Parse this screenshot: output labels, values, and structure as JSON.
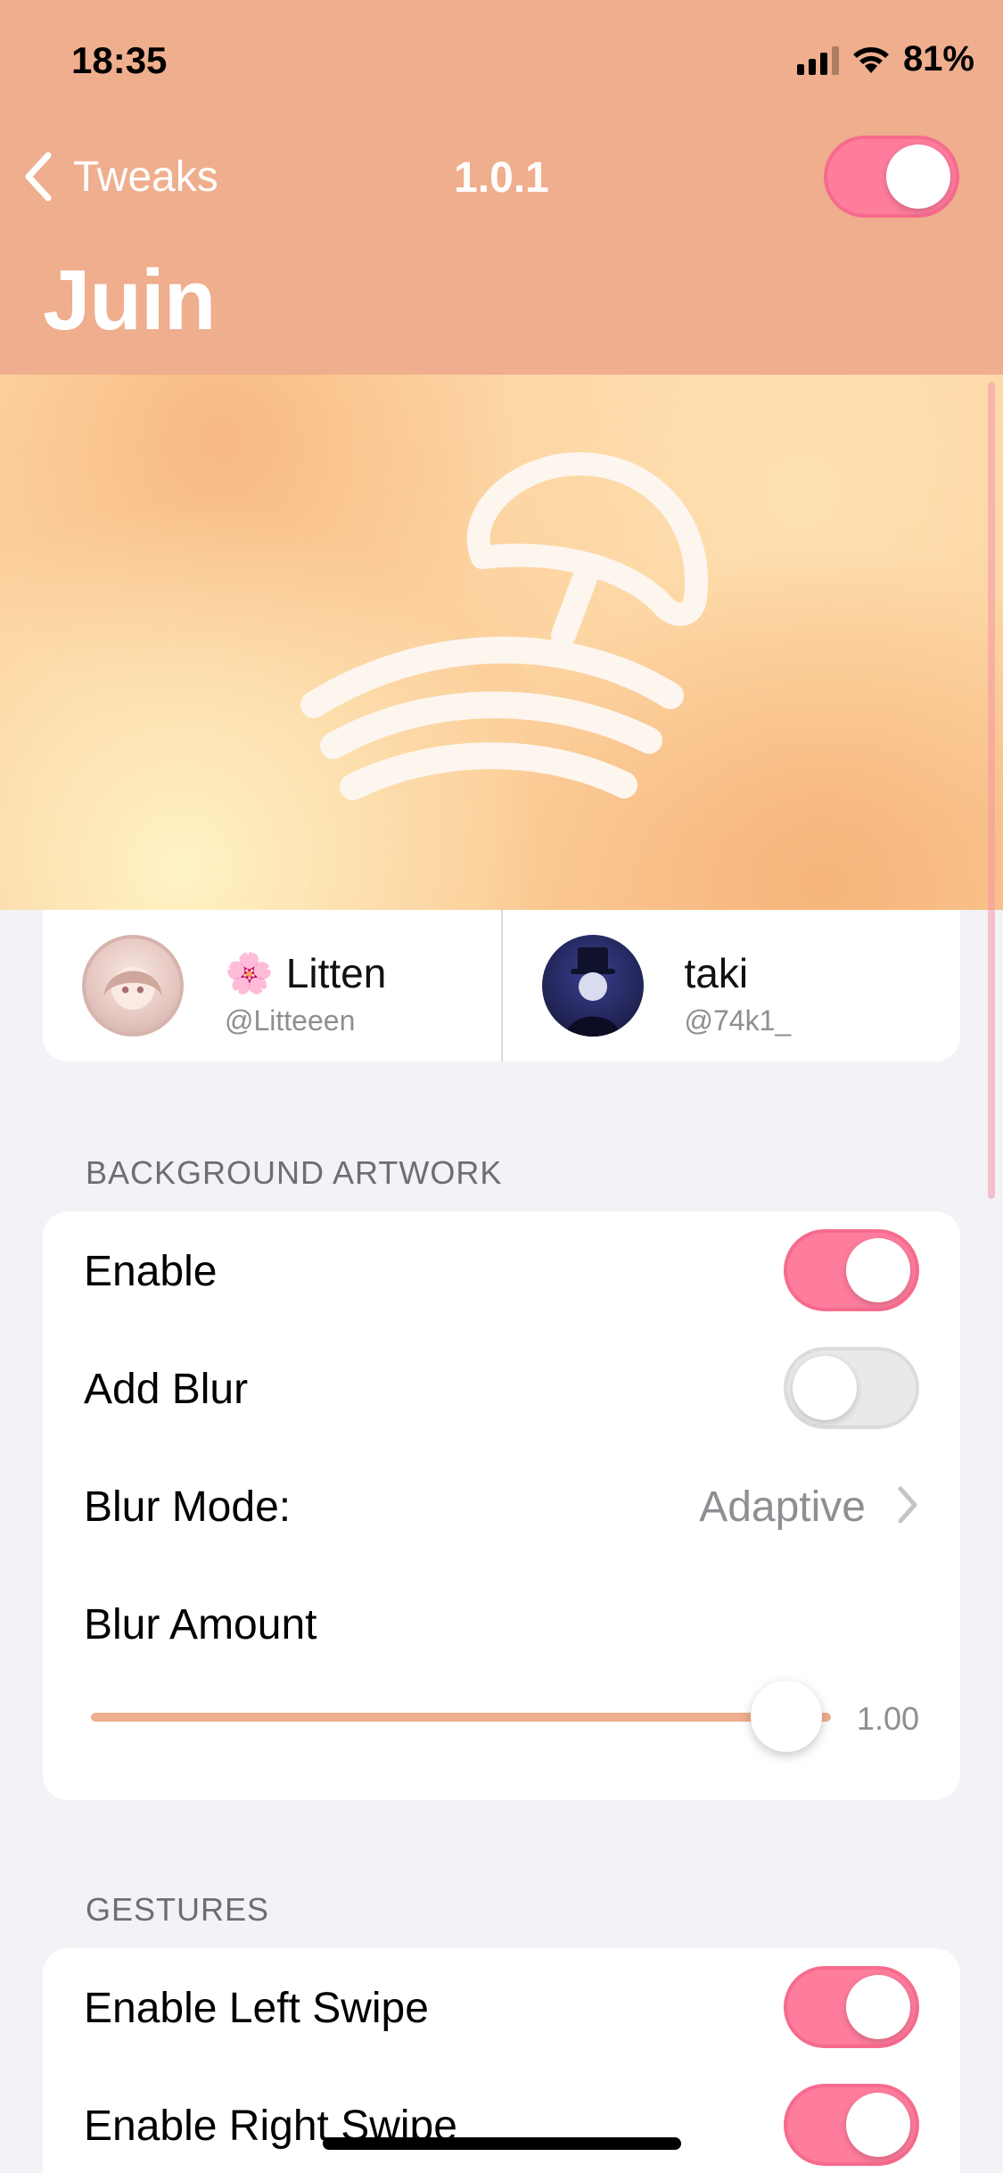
{
  "status_bar": {
    "time": "18:35",
    "battery": "81%"
  },
  "nav": {
    "back_label": "Tweaks",
    "title": "1.0.1",
    "large_title": "Juin",
    "master_toggle_on": true
  },
  "credits": [
    {
      "emoji": "🌸",
      "name": "Litten",
      "handle": "@Litteeen"
    },
    {
      "emoji": "",
      "name": "taki",
      "handle": "@74k1_"
    }
  ],
  "background_artwork": {
    "header": "BACKGROUND ARTWORK",
    "enable_label": "Enable",
    "enable_on": true,
    "add_blur_label": "Add Blur",
    "add_blur_on": false,
    "blur_mode_label": "Blur Mode:",
    "blur_mode_value": "Adaptive",
    "blur_amount_label": "Blur Amount",
    "blur_amount_value": "1.00",
    "blur_amount_fraction": 1.0
  },
  "gestures": {
    "header": "GESTURES",
    "left_swipe_label": "Enable Left Swipe",
    "left_swipe_on": true,
    "right_swipe_label": "Enable Right Swipe",
    "right_swipe_on": true
  },
  "colors": {
    "header_bg": "#efae8d",
    "toggle_on": "#fe7c9c",
    "slider_fill": "#efae8d"
  },
  "icons": {
    "back": "chevron-left-icon",
    "banner": "beach-umbrella-waves-icon",
    "disclosure": "chevron-right-icon"
  }
}
